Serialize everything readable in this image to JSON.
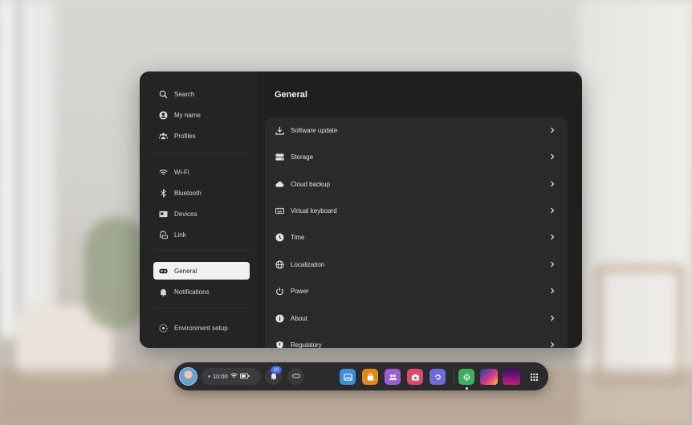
{
  "sidebar": {
    "items": [
      {
        "label": "Search",
        "icon": "search-icon"
      },
      {
        "label": "My name",
        "icon": "user-icon"
      },
      {
        "label": "Profiles",
        "icon": "people-icon"
      },
      {
        "label": "Wi-Fi",
        "icon": "wifi-icon"
      },
      {
        "label": "Bluetooth",
        "icon": "bluetooth-icon"
      },
      {
        "label": "Devices",
        "icon": "devices-icon"
      },
      {
        "label": "Link",
        "icon": "link-icon"
      },
      {
        "label": "General",
        "icon": "headset-icon",
        "active": true
      },
      {
        "label": "Notifications",
        "icon": "bell-icon"
      },
      {
        "label": "Environment setup",
        "icon": "environment-icon"
      }
    ]
  },
  "main": {
    "title": "General",
    "rows": [
      {
        "label": "Software update",
        "icon": "download-icon"
      },
      {
        "label": "Storage",
        "icon": "storage-icon"
      },
      {
        "label": "Cloud backup",
        "icon": "cloud-icon"
      },
      {
        "label": "Virtual keyboard",
        "icon": "keyboard-icon"
      },
      {
        "label": "Time",
        "icon": "clock-icon"
      },
      {
        "label": "Localization",
        "icon": "globe-icon"
      },
      {
        "label": "Power",
        "icon": "power-icon"
      },
      {
        "label": "About",
        "icon": "info-icon"
      },
      {
        "label": "Regulatory",
        "icon": "shield-icon"
      }
    ]
  },
  "dock": {
    "time": "10:00",
    "notification_count": "10",
    "apps": [
      "gallery-app",
      "store-app",
      "people-app",
      "camera-app",
      "browser-app",
      "settings-app",
      "game-app-1",
      "game-app-2",
      "app-grid"
    ]
  },
  "colors": {
    "panel": "#1f1f20",
    "sidebar": "#242425",
    "active_item": "#f1f1f1",
    "badge": "#3c6cf0"
  }
}
